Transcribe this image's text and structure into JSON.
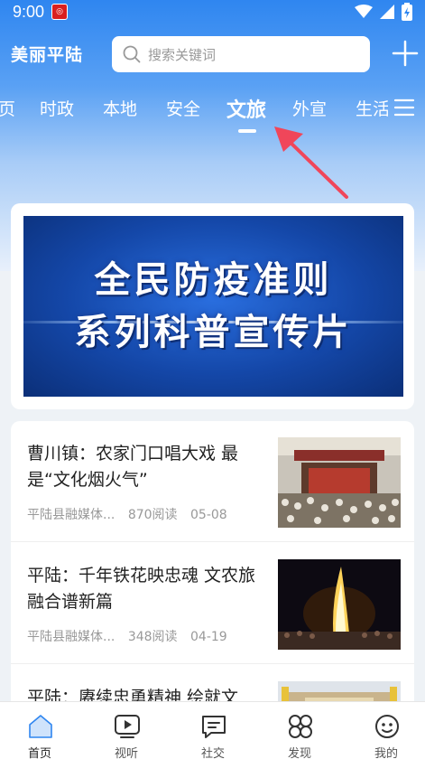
{
  "status_bar": {
    "time": "9:00"
  },
  "header": {
    "brand": "美丽平陆",
    "search_placeholder": "搜索关键词"
  },
  "tabs": [
    {
      "label": "页"
    },
    {
      "label": "时政"
    },
    {
      "label": "本地"
    },
    {
      "label": "安全"
    },
    {
      "label": "文旅",
      "active": true
    },
    {
      "label": "外宣"
    },
    {
      "label": "生活"
    }
  ],
  "banner": {
    "line1": "全民防疫准则",
    "line2": "系列科普宣传片"
  },
  "news": [
    {
      "title": "曹川镇：农家门口唱大戏 最是“文化烟火气”",
      "source": "平陆县融媒体...",
      "reads": "870阅读",
      "date": "05-08"
    },
    {
      "title": "平陆：千年铁花映忠魂 文农旅融合谱新篇",
      "source": "平陆县融媒体...",
      "reads": "348阅读",
      "date": "04-19"
    },
    {
      "title": "平陆：赓续忠勇精神 绘就文",
      "source": "",
      "reads": "",
      "date": ""
    }
  ],
  "bottom_nav": [
    {
      "label": "首页",
      "icon": "home-icon",
      "active": true
    },
    {
      "label": "视听",
      "icon": "video-icon"
    },
    {
      "label": "社交",
      "icon": "chat-icon"
    },
    {
      "label": "发现",
      "icon": "discover-icon"
    },
    {
      "label": "我的",
      "icon": "profile-icon"
    }
  ],
  "colors": {
    "accent": "#2f86f0",
    "annotation_arrow": "#f0465a"
  }
}
